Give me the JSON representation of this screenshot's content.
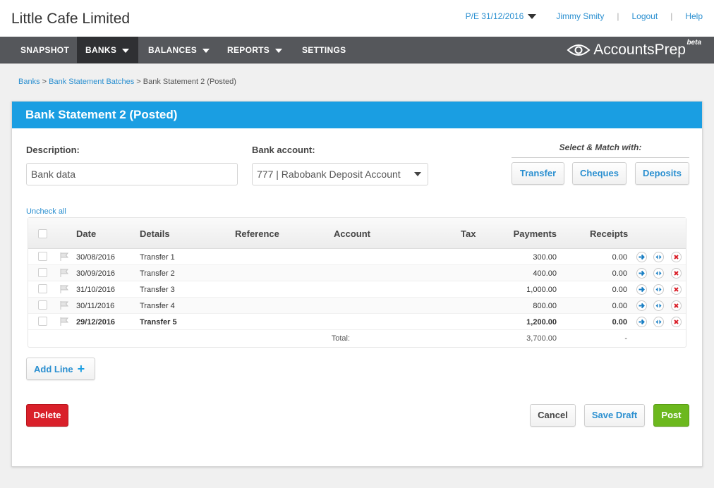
{
  "header": {
    "company": "Little Cafe Limited",
    "period": "P/E 31/12/2016",
    "user": "Jimmy Smity",
    "logout": "Logout",
    "help": "Help"
  },
  "nav": {
    "items": [
      {
        "label": "SNAPSHOT",
        "active": false,
        "dropdown": false
      },
      {
        "label": "BANKS",
        "active": true,
        "dropdown": true
      },
      {
        "label": "BALANCES",
        "active": false,
        "dropdown": true
      },
      {
        "label": "REPORTS",
        "active": false,
        "dropdown": true
      },
      {
        "label": "SETTINGS",
        "active": false,
        "dropdown": false
      }
    ],
    "logo": "AccountsPrep",
    "logo_badge": "beta"
  },
  "breadcrumb": {
    "items": [
      "Banks",
      "Bank Statement Batches"
    ],
    "current": "Bank Statement 2 (Posted)",
    "separator": ">"
  },
  "card": {
    "title": "Bank Statement 2 (Posted)",
    "description_label": "Description:",
    "description_value": "Bank data",
    "bank_account_label": "Bank account:",
    "bank_account_value": "777 | Rabobank Deposit Account",
    "match_title": "Select & Match with:",
    "match_buttons": [
      "Transfer",
      "Cheques",
      "Deposits"
    ],
    "uncheck_all": "Uncheck all"
  },
  "table": {
    "columns": [
      "Date",
      "Details",
      "Reference",
      "Account",
      "Tax",
      "Payments",
      "Receipts"
    ],
    "rows": [
      {
        "date": "30/08/2016",
        "details": "Transfer 1",
        "reference": "",
        "account": "",
        "tax": "",
        "payments": "300.00",
        "receipts": "0.00"
      },
      {
        "date": "30/09/2016",
        "details": "Transfer 2",
        "reference": "",
        "account": "",
        "tax": "",
        "payments": "400.00",
        "receipts": "0.00"
      },
      {
        "date": "31/10/2016",
        "details": "Transfer 3",
        "reference": "",
        "account": "",
        "tax": "",
        "payments": "1,000.00",
        "receipts": "0.00"
      },
      {
        "date": "30/11/2016",
        "details": "Transfer 4",
        "reference": "",
        "account": "",
        "tax": "",
        "payments": "800.00",
        "receipts": "0.00"
      },
      {
        "date": "29/12/2016",
        "details": "Transfer 5",
        "reference": "",
        "account": "",
        "tax": "",
        "payments": "1,200.00",
        "receipts": "0.00"
      }
    ],
    "total_label": "Total:",
    "total_payments": "3,700.00",
    "total_receipts": "-"
  },
  "actions": {
    "add_line": "Add Line",
    "add_line_icon": "+",
    "delete": "Delete",
    "cancel": "Cancel",
    "save_draft": "Save Draft",
    "post": "Post"
  },
  "colors": {
    "accent": "#1a9ee2",
    "nav_bg": "#55575b",
    "delete": "#d9202a",
    "post": "#6cb81e"
  }
}
